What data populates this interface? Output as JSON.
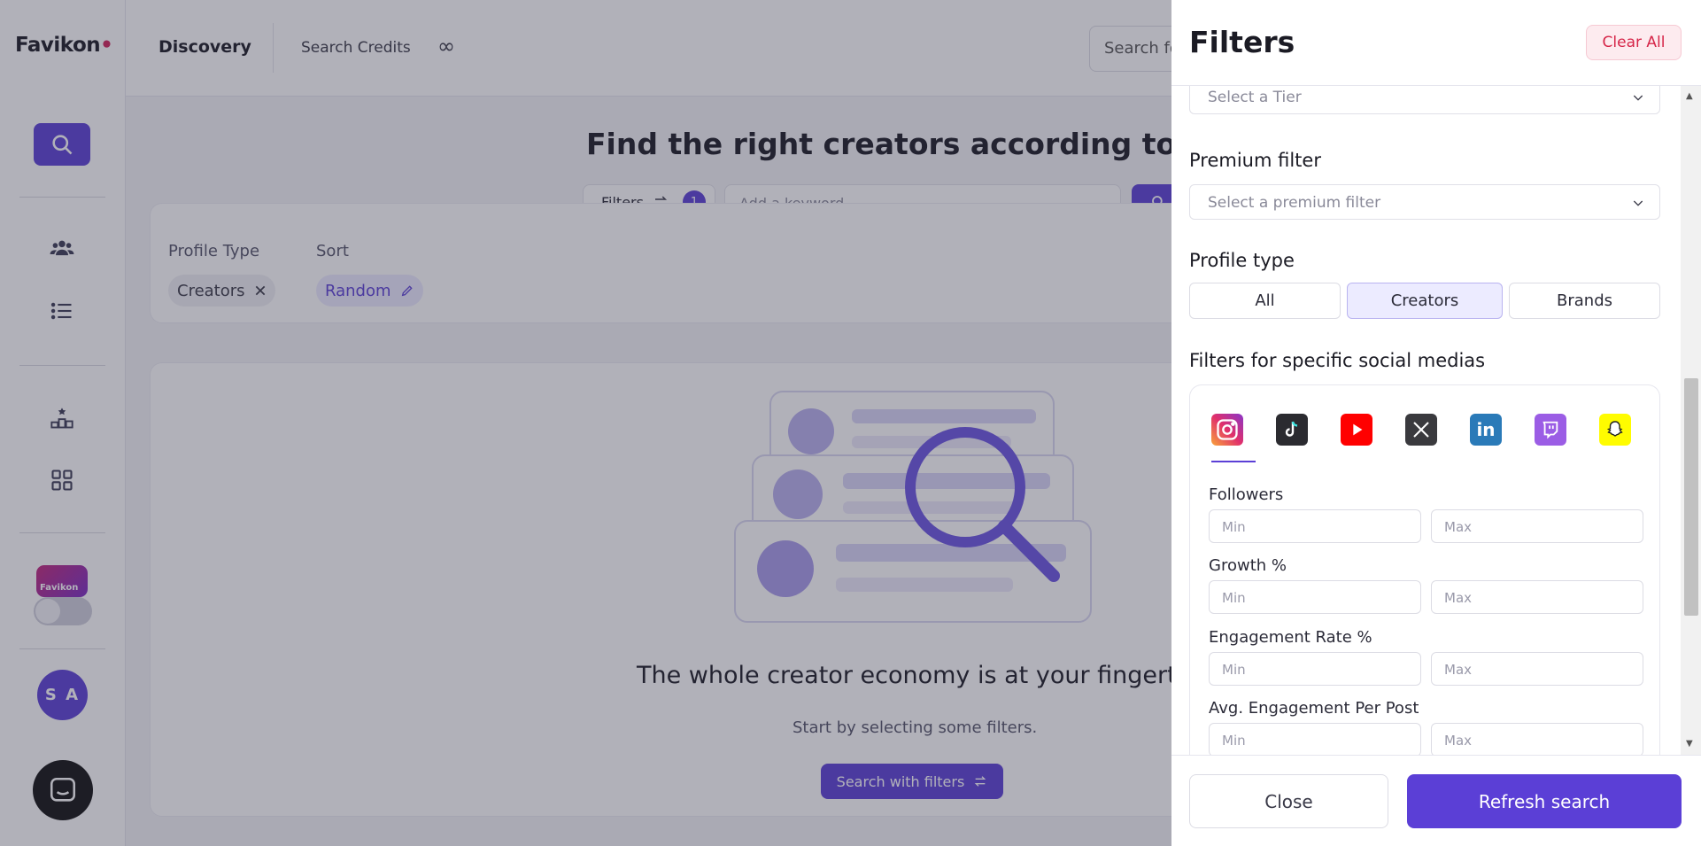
{
  "app": {
    "logo": "Favikon",
    "brand_avatar_text": "Favikon",
    "user_initials": "S A"
  },
  "topbar": {
    "title": "Discovery",
    "credits_label": "Search Credits",
    "credits_value": "∞",
    "search_placeholder": "Search fo"
  },
  "main": {
    "heading": "Find the right creators according to your ne",
    "filters_label": "Filters",
    "filters_count": "1",
    "keyword_placeholder": "Add a keyword",
    "profile_type_label": "Profile Type",
    "profile_type_value": "Creators",
    "sort_label": "Sort",
    "sort_value": "Random",
    "empty_title": "The whole creator economy is at your fingertips",
    "empty_sub": "Start by selecting some filters.",
    "search_with_filters": "Search with filters"
  },
  "drawer": {
    "title": "Filters",
    "clear_all": "Clear All",
    "tier_placeholder": "Select a Tier",
    "premium_label": "Premium filter",
    "premium_placeholder": "Select a premium filter",
    "profile_type_label": "Profile type",
    "profile_types": [
      "All",
      "Creators",
      "Brands"
    ],
    "profile_type_selected": "Creators",
    "social_label": "Filters for specific social medias",
    "social_networks": [
      "instagram-icon",
      "tiktok-icon",
      "youtube-icon",
      "x-icon",
      "linkedin-icon",
      "twitch-icon",
      "snapchat-icon"
    ],
    "social_selected": "instagram-icon",
    "fields": [
      {
        "label": "Followers",
        "min": "Min",
        "max": "Max"
      },
      {
        "label": "Growth %",
        "min": "Min",
        "max": "Max"
      },
      {
        "label": "Engagement Rate %",
        "min": "Min",
        "max": "Max"
      },
      {
        "label": "Avg. Engagement Per Post",
        "min": "Min",
        "max": "Max"
      }
    ],
    "close": "Close",
    "refresh": "Refresh search"
  },
  "colors": {
    "accent": "#5b3fd6",
    "danger": "#d62649"
  }
}
